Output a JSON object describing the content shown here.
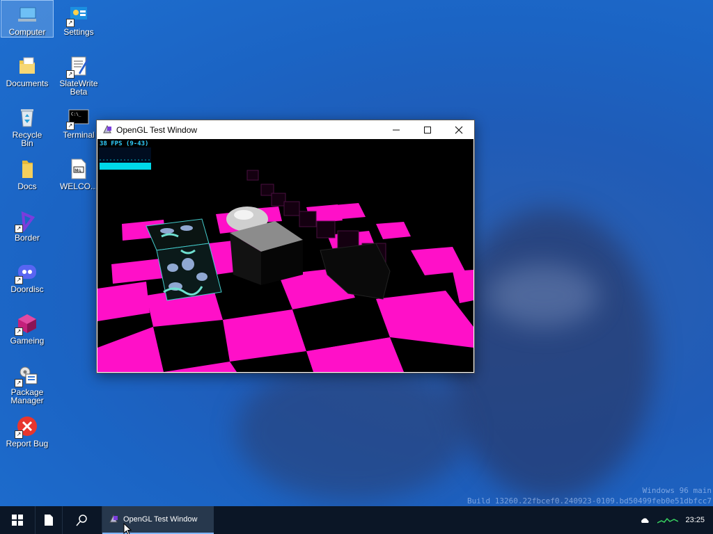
{
  "desktop": {
    "icons": [
      {
        "label": "Computer",
        "icon": "computer-icon"
      },
      {
        "label": "Settings",
        "icon": "settings-icon"
      },
      {
        "label": "Documents",
        "icon": "documents-icon"
      },
      {
        "label": "SlateWrite Beta",
        "icon": "slatewrite-icon"
      },
      {
        "label": "Recycle Bin",
        "icon": "recycle-bin-icon"
      },
      {
        "label": "Terminal",
        "icon": "terminal-icon"
      },
      {
        "label": "Docs",
        "icon": "folder-icon"
      },
      {
        "label": "WELCO...",
        "icon": "markdown-file-icon"
      },
      {
        "label": "Border",
        "icon": "border-icon"
      },
      {
        "label": "Doordisc",
        "icon": "doordisc-icon"
      },
      {
        "label": "Gameing",
        "icon": "gameing-icon"
      },
      {
        "label": "Package Manager",
        "icon": "package-manager-icon"
      },
      {
        "label": "Report Bug",
        "icon": "report-bug-icon"
      }
    ]
  },
  "window": {
    "title": "OpenGL Test Window",
    "fps": "38 FPS (9-43)",
    "controls": {
      "minimize": "minimize-icon",
      "maximize": "maximize-icon",
      "close": "close-icon"
    }
  },
  "taskbar": {
    "task_label": "OpenGL Test Window",
    "clock": "23:25"
  },
  "watermark": {
    "line1": "Windows 96 main",
    "line2": "Build 13260.22fbcef0.240923-0109.bd50499feb0e51dbfcc7"
  },
  "colors": {
    "checker": "#ff10c8",
    "fps_text": "#30d0ff",
    "fps_bar": "#00d8e8",
    "taskbar": "#0b1626"
  }
}
